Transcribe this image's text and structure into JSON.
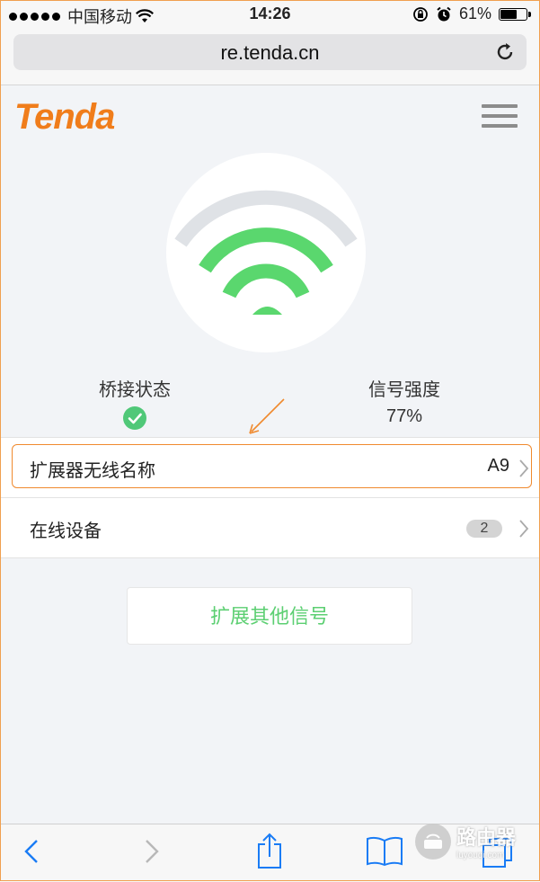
{
  "status_bar": {
    "carrier": "中国移动",
    "time": "14:26",
    "battery": "61%"
  },
  "browser": {
    "url": "re.tenda.cn"
  },
  "brand": {
    "logo_text": "Tenda",
    "accent_color": "#f07d1b"
  },
  "signal_icon": {
    "active_color": "#5ad76e",
    "inactive_color": "#dfe2e6"
  },
  "stats": {
    "bridge_label": "桥接状态",
    "signal_label": "信号强度",
    "signal_value": "77%"
  },
  "list": {
    "extender_ssid_label": "扩展器无线名称",
    "extender_ssid_value": "A9",
    "online_devices_label": "在线设备",
    "online_devices_count": "2"
  },
  "actions": {
    "extend_other_label": "扩展其他信号"
  },
  "watermark": {
    "text": "路由器",
    "sub": "luyouqi.com"
  }
}
